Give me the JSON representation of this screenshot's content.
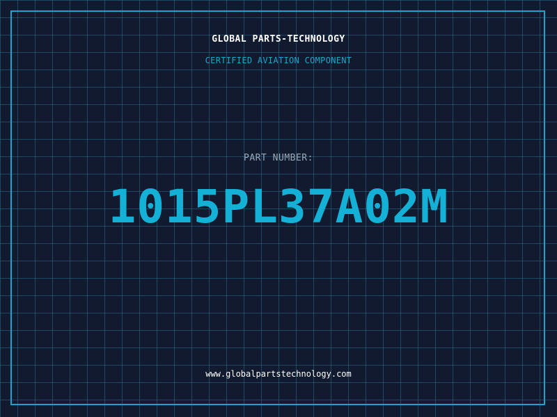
{
  "header": {
    "brand": "GLOBAL PARTS-TECHNOLOGY",
    "subtitle": "CERTIFIED AVIATION COMPONENT"
  },
  "part": {
    "label": "PART NUMBER:",
    "number": "1015PL37A02M"
  },
  "footer": {
    "url": "www.globalpartstechnology.com"
  },
  "colors": {
    "background": "#111a2e",
    "grid": "#286e8c",
    "accent": "#14b0d6",
    "text": "#ffffff",
    "label": "#9aa8b8"
  }
}
